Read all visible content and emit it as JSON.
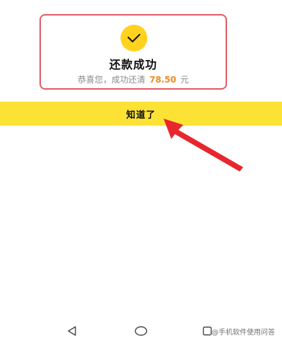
{
  "result_dialog": {
    "title": "还款成功",
    "message_prefix": "恭喜您，成功还清",
    "amount": "78.50",
    "currency": "元",
    "status_icon": "check-icon"
  },
  "action": {
    "got_it_label": "知道了"
  },
  "annotation": {
    "icon": "red-arrow-icon",
    "color": "#e8262e"
  },
  "nav_bar": {
    "back_icon": "back-triangle-icon",
    "home_icon": "home-circle-icon",
    "recent_icon": "recent-square-icon"
  },
  "watermark": {
    "text": "@手机软件使用问答"
  },
  "colors": {
    "accent_yellow": "#fde236",
    "amount_orange": "#f08a24",
    "highlight_border": "#e05a63"
  }
}
